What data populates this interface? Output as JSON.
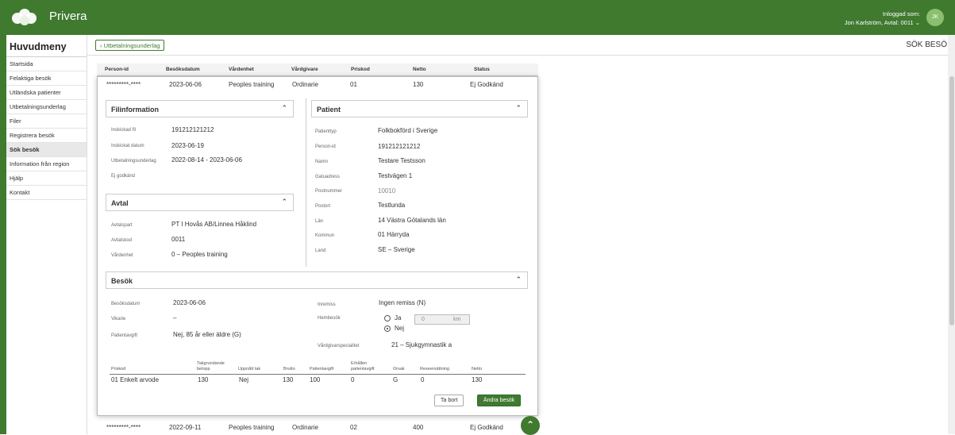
{
  "header": {
    "brand": "Privera",
    "user_line1": "Inloggad som:",
    "user_line2": "Jon Karlström, Avtal: 0011 ⌄",
    "avatar_initials": "JK",
    "color": "#3f7a2f"
  },
  "sidebar": {
    "title": "Huvudmeny",
    "items": [
      {
        "label": "Startsida"
      },
      {
        "label": "Felaktiga besök"
      },
      {
        "label": "Utländska patienter"
      },
      {
        "label": "Utbetalningsunderlag"
      },
      {
        "label": "Filer"
      },
      {
        "label": "Registrera besök"
      },
      {
        "label": "Sök besök",
        "active": true
      },
      {
        "label": "Information från region"
      },
      {
        "label": "Hjälp"
      },
      {
        "label": "Kontakt"
      }
    ]
  },
  "subheader": {
    "back_label": "‹ Utbetalningsunderlag",
    "page_title": "SÖK BESÖ"
  },
  "grid": {
    "columns": [
      "Person-id",
      "Besöksdatum",
      "Vårdenhet",
      "Vårdgivare",
      "Priskod",
      "Netto",
      "Status"
    ],
    "rows": [
      [
        "*********-****",
        "2023-06-06",
        "Peoples training",
        "Ordinarie",
        "01",
        "130",
        "Ej Godkänd"
      ],
      [
        "*********-****",
        "2022-09-11",
        "Peoples training",
        "Ordinarie",
        "02",
        "400",
        "Ej Godkänd"
      ]
    ]
  },
  "filinformation": {
    "title": "Filinformation",
    "fields": [
      {
        "label": "Inskickad fil",
        "value": "191212121212"
      },
      {
        "label": "Inskickat datum",
        "value": "2023-06-19"
      },
      {
        "label": "Utbetalningsunderlag",
        "value": "2022-08-14 - 2023-06-06"
      },
      {
        "label": "Ej godkänd",
        "value": ""
      }
    ]
  },
  "avtal": {
    "title": "Avtal",
    "fields": [
      {
        "label": "Avtalspart",
        "value": "PT I Hovås AB/Linnea Håklind"
      },
      {
        "label": "Avtalskod",
        "value": "0011"
      },
      {
        "label": "Vårdenhet",
        "value": "0 – Peoples training"
      }
    ]
  },
  "patient": {
    "title": "Patient",
    "fields": [
      {
        "label": "Patienttyp",
        "value": "Folkbokförd i Sverige"
      },
      {
        "label": "Person-id",
        "value": "191212121212"
      },
      {
        "label": "Namn",
        "value": "Testare Testsson"
      },
      {
        "label": "Gatuadress",
        "value": "Testvägen 1"
      },
      {
        "label": "Postnummer",
        "value": "10010"
      },
      {
        "label": "Postort",
        "value": "Testlunda"
      },
      {
        "label": "Län",
        "value": "14   Västra Götalands län"
      },
      {
        "label": "Kommun",
        "value": "01   Härryda"
      },
      {
        "label": "Land",
        "value": "SE – Sverige"
      }
    ]
  },
  "besok": {
    "title": "Besök",
    "besoksdatum_label": "Besöksdatum",
    "besoksdatum": "2023-06-06",
    "vikarie_label": "Vikarie",
    "vikarie": "–",
    "patientavgift_label": "Patientavgift",
    "patientavgift": "Nej, 85 år eller äldre (G)",
    "inremiss_label": "Inremiss",
    "inremiss": "Ingen remiss (N)",
    "hembesok_label": "Hembesök",
    "hembesok_ja": "Ja",
    "hembesok_nej": "Nej",
    "hembesok_selected": "Nej",
    "km_value": "0",
    "km_unit": "km",
    "specialitet_label": "Vårdgivarspecialitet",
    "specialitet": "21 – Sjukgymnastik a",
    "table": {
      "headers": [
        "Priskod",
        "Takgrundande belopp",
        "Uppnått tak",
        "Brutto",
        "Patientavgift",
        "Erhållen patientavgift",
        "Orsak",
        "Reseersättning",
        "Netto"
      ],
      "row": [
        "01 Enkelt arvode",
        "130",
        "Nej",
        "130",
        "100",
        "0",
        "G",
        "0",
        "130"
      ]
    },
    "remove_label": "Ta bort",
    "edit_label": "Ändra besök"
  }
}
